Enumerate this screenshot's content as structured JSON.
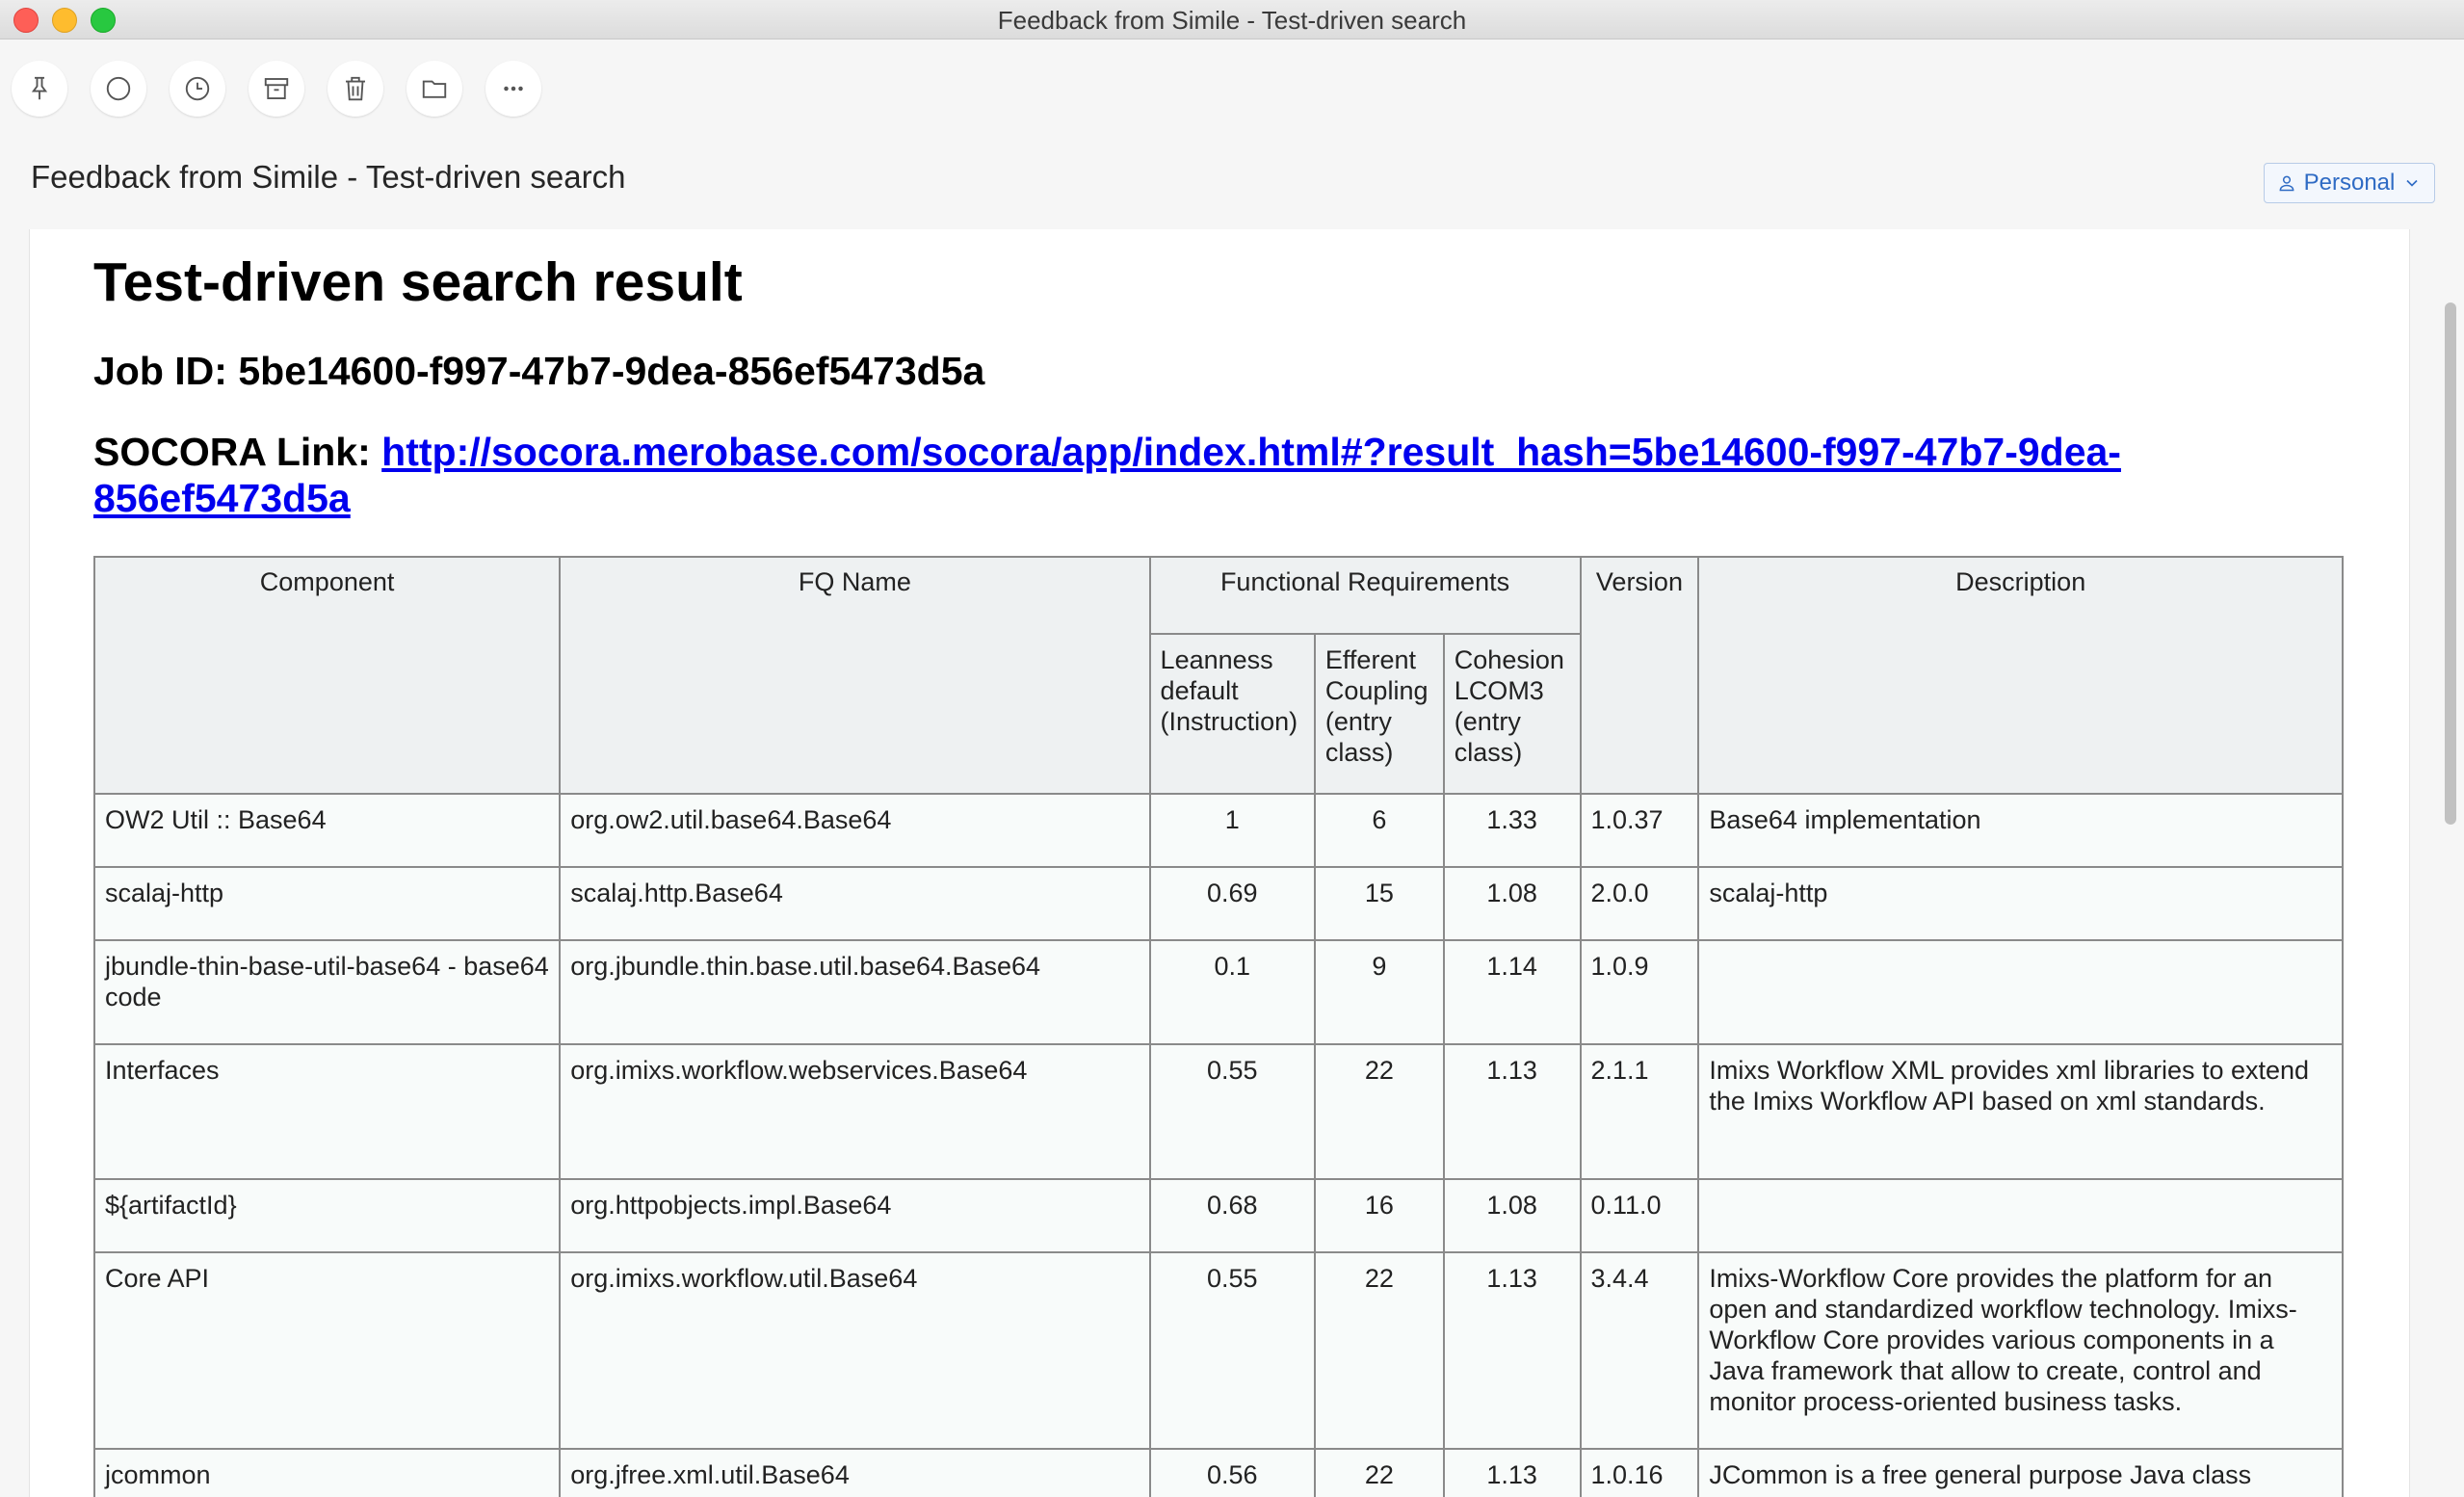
{
  "window": {
    "title": "Feedback from Simile - Test-driven search"
  },
  "toolbar": {
    "buttons": [
      {
        "icon": "pin-icon",
        "label": "Pin"
      },
      {
        "icon": "circle-icon",
        "label": "Mark unread"
      },
      {
        "icon": "clock-icon",
        "label": "Snooze"
      },
      {
        "icon": "archive-icon",
        "label": "Archive"
      },
      {
        "icon": "trash-icon",
        "label": "Delete"
      },
      {
        "icon": "folder-icon",
        "label": "Move"
      },
      {
        "icon": "more-icon",
        "label": "More"
      }
    ]
  },
  "message": {
    "subject": "Feedback from Simile - Test-driven search",
    "account": "Personal"
  },
  "document": {
    "title": "Test-driven search result",
    "job_label": "Job ID:",
    "job_id": "5be14600-f997-47b7-9dea-856ef5473d5a",
    "link_label": "SOCORA Link:",
    "link_url": "http://socora.merobase.com/socora/app/index.html#?result_hash=5be14600-f997-47b7-9dea-856ef5473d5a"
  },
  "table": {
    "headers": {
      "component": "Component",
      "fq_name": "FQ Name",
      "functional": "Functional Requirements",
      "version": "Version",
      "description": "Description",
      "leanness": "Leanness default (Instruction)",
      "coupling": "Efferent Coupling (entry class)",
      "cohesion": "Cohesion LCOM3 (entry class)"
    },
    "rows": [
      {
        "component": "OW2 Util :: Base64",
        "fq": "org.ow2.util.base64.Base64",
        "leanness": "1",
        "coupling": "6",
        "cohesion": "1.33",
        "version": "1.0.37",
        "description": "Base64 implementation"
      },
      {
        "component": "scalaj-http",
        "fq": "scalaj.http.Base64",
        "leanness": "0.69",
        "coupling": "15",
        "cohesion": "1.08",
        "version": "2.0.0",
        "description": "scalaj-http"
      },
      {
        "component": "jbundle-thin-base-util-base64 - base64 code",
        "fq": "org.jbundle.thin.base.util.base64.Base64",
        "leanness": "0.1",
        "coupling": "9",
        "cohesion": "1.14",
        "version": "1.0.9",
        "description": ""
      },
      {
        "component": "Interfaces",
        "fq": "org.imixs.workflow.webservices.Base64",
        "leanness": "0.55",
        "coupling": "22",
        "cohesion": "1.13",
        "version": "2.1.1",
        "description": "Imixs Workflow XML provides xml libraries to extend the Imixs Workflow API based on xml standards."
      },
      {
        "component": "${artifactId}",
        "fq": "org.httpobjects.impl.Base64",
        "leanness": "0.68",
        "coupling": "16",
        "cohesion": "1.08",
        "version": "0.11.0",
        "description": ""
      },
      {
        "component": "Core API",
        "fq": "org.imixs.workflow.util.Base64",
        "leanness": "0.55",
        "coupling": "22",
        "cohesion": "1.13",
        "version": "3.4.4",
        "description": "Imixs-Workflow Core provides the platform for an open and standardized workflow technology. Imixs-Workflow Core provides various components in a Java framework that allow to create, control and monitor process-oriented business tasks."
      },
      {
        "component": "jcommon",
        "fq": "org.jfree.xml.util.Base64",
        "leanness": "0.56",
        "coupling": "22",
        "cohesion": "1.13",
        "version": "1.0.16",
        "description": "JCommon is a free general purpose Java class"
      }
    ]
  }
}
